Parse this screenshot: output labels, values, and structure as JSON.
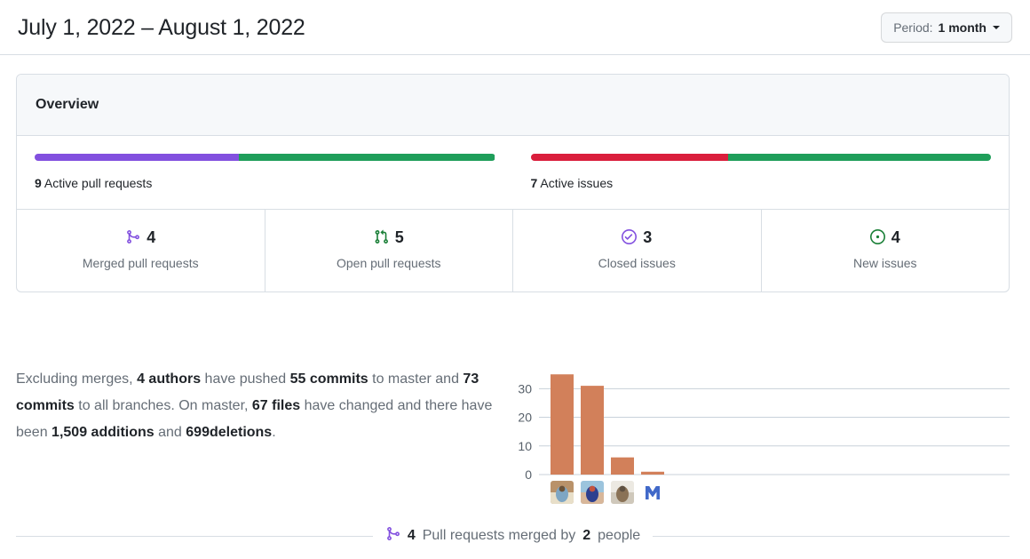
{
  "header": {
    "title": "July 1, 2022 – August 1, 2022",
    "period": {
      "label": "Period:",
      "value": "1 month",
      "caret_icon": "chevron-down-icon"
    }
  },
  "overview": {
    "card_title": "Overview",
    "pull_requests": {
      "count": "9",
      "caption": "Active pull requests",
      "merged_segment_pct": 44.4,
      "open_segment_pct": 55.6,
      "merged_color": "#8250df",
      "open_color": "#1f9e5a"
    },
    "issues": {
      "count": "7",
      "caption": "Active issues",
      "closed_segment_pct": 42.9,
      "new_segment_pct": 57.1,
      "closed_color": "#da1e3c",
      "new_color": "#1f9e5a"
    },
    "stats": [
      {
        "icon": "git-merge-icon",
        "icon_color": "#8250df",
        "value": "4",
        "label": "Merged pull requests"
      },
      {
        "icon": "git-pull-request-icon",
        "icon_color": "#1a7f37",
        "value": "5",
        "label": "Open pull requests"
      },
      {
        "icon": "issue-closed-check-icon",
        "icon_color": "#8250df",
        "value": "3",
        "label": "Closed issues"
      },
      {
        "icon": "issue-opened-icon",
        "icon_color": "#1a7f37",
        "value": "4",
        "label": "New issues"
      }
    ]
  },
  "commits_summary": {
    "lead": "Excluding merges,",
    "authors": "4 authors",
    "pushed": "have pushed",
    "master_commits": "55 commits",
    "to_master": "to master and",
    "all_commits": "73 commits",
    "to_all": "to all branches. On master,",
    "files": "67 files",
    "changed": "have changed and there have been",
    "additions_value": "1,509",
    "additions_word": "additions",
    "and": "and",
    "deletions_value": "699",
    "deletions_word": "deletions",
    "period": "."
  },
  "chart_data": {
    "type": "bar",
    "title": "",
    "xlabel": "",
    "ylabel": "",
    "categories": [
      "author-1",
      "author-2",
      "author-3",
      "author-4"
    ],
    "values": [
      35,
      31,
      6,
      1
    ],
    "ylim": [
      0,
      36
    ],
    "yticks": [
      0,
      10,
      20,
      30
    ],
    "ytick_labels": [
      "0",
      "10",
      "20",
      "30"
    ],
    "grid": true,
    "legend": "none",
    "bar_color": "#d2805a",
    "gridline_color": "#c8d1da",
    "tick_label_color": "#57606a",
    "avatars": [
      {
        "name": "avatar-author-1",
        "kind": "photo-archway-beach",
        "colors": [
          "#b9926a",
          "#7ea6c4",
          "#e8dfc9",
          "#6b5238"
        ]
      },
      {
        "name": "avatar-author-2",
        "kind": "photo-person-blue-shirt",
        "colors": [
          "#9cc4dd",
          "#2d3f8f",
          "#d8b79a",
          "#c4543f"
        ]
      },
      {
        "name": "avatar-author-3",
        "kind": "photo-person-white-shirt",
        "colors": [
          "#ece9e2",
          "#8a7256",
          "#cfc8bb",
          "#5f5142"
        ]
      },
      {
        "name": "avatar-logo-m",
        "kind": "logo-letter-m",
        "colors": [
          "#ffffff",
          "#4169c9"
        ]
      }
    ]
  },
  "merged_section": {
    "icon": "git-merge-icon",
    "icon_color": "#8250df",
    "count": "4",
    "text_middle": "Pull requests merged by",
    "people_count": "2",
    "text_end": "people"
  }
}
